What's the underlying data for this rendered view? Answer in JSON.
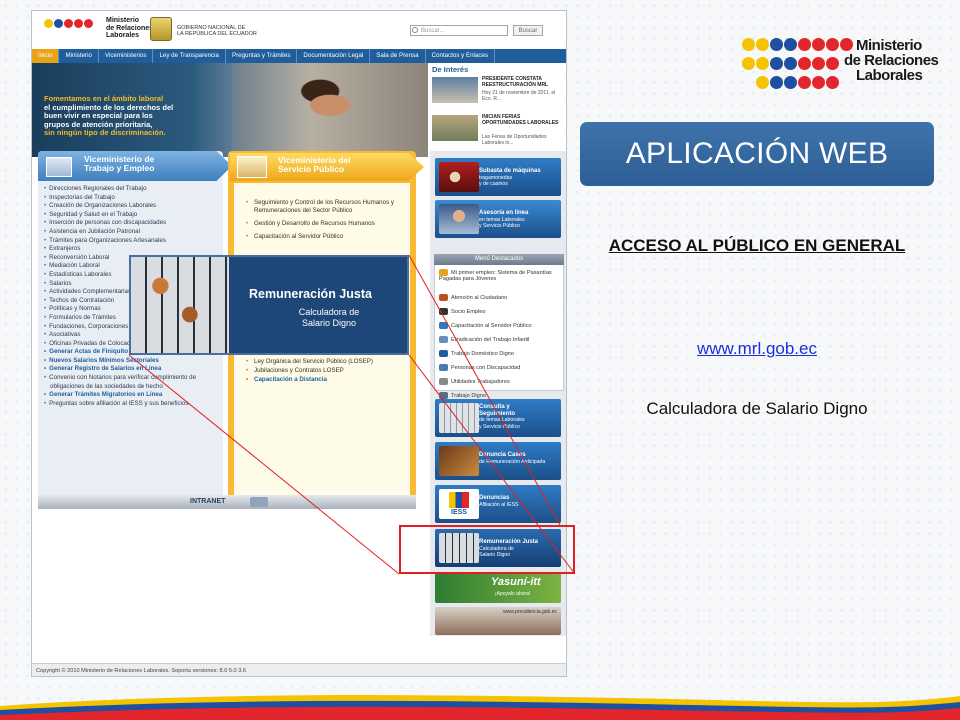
{
  "slide": {
    "brand": {
      "line1": "Ministerio",
      "line2": "de Relaciones",
      "line3": "Laborales",
      "dot_colors": [
        "#f5c400",
        "#f5c400",
        "#1f4fa0",
        "#1f4fa0",
        "#e3262c",
        "#e3262c",
        "#e3262c",
        "#e3262c"
      ]
    },
    "app_button": "APLICACIÓN WEB",
    "access_title": "ACCESO AL PÚBLICO EN GENERAL",
    "url": "www.mrl.gob.ec",
    "calc_label": "Calculadora de Salario Digno"
  },
  "site": {
    "header": {
      "mrl_line1": "Ministerio",
      "mrl_line2": "de Relaciones",
      "mrl_line3": "Laborales",
      "gob_line1": "GOBIERNO NACIONAL DE",
      "gob_line2": "LA REPÚBLICA DEL ECUADOR",
      "search_placeholder": "Buscar...",
      "search_button": "Buscar"
    },
    "nav": [
      "Inicio",
      "Ministerio",
      "Viceministerios",
      "Ley de Transparencia",
      "Preguntas y Trámites",
      "Documentación Legal",
      "Sala de Prensa",
      "Contactos y Enlaces"
    ],
    "banner": {
      "line1": "Fomentamos en el ámbito laboral",
      "line2": "el cumplimiento de los derechos del",
      "line3": "buen vivir en especial para los",
      "line4": "grupos de atención prioritaria,",
      "line5": "sin ningún tipo de discriminación."
    },
    "interes": {
      "title": "De Interés",
      "news": [
        {
          "title": "PRESIDENTE CONSTATA REESTRUCTURACIÓN MRL",
          "desc": "Hoy 21 de noviembre de 2011, el Eco. R..."
        },
        {
          "title": "INICIAN FERIAS OPORTUNIDADES LABORALES",
          "desc": "Las Ferias de Oportunidades Laborales in..."
        }
      ]
    },
    "blue_column": {
      "title_line1": "Viceministerio de",
      "title_line2": "Trabajo y Empleo",
      "links": [
        "Direcciones Regionales del Trabajo",
        "Inspectorias del Trabajo",
        "Creación de Organizaciones Laborales",
        "Seguridad y Salud en el Trabajo",
        "Inserción de personas con discapacidades",
        "Asistencia en Jubilación Patronal",
        "Trámites para Organizaciones Artesanales",
        "Extranjeros",
        "Reconversión Laboral",
        "Mediación Laboral",
        "Estadísticas Laborales",
        "Salarios",
        "Actividades Complementarias",
        "Techos de Contratación",
        "Políticas y Normas",
        "Formularios de Trámites",
        "Fundaciones, Corporaciones y",
        "Asociativas",
        "Oficinas Privadas de Colocaciones"
      ],
      "bold_links": [
        "Generar Actas de Finiquito en Línea",
        "Nuevos Salarios Mínimos Sectoriales",
        "Generar Registro de Salarios en Línea"
      ],
      "extra_links": [
        "Convenio con Notarios para verificar cumplimiento de obligaciones de las sociedades de hecho",
        "Generar Trámites Migratorios en Línea",
        "Preguntas sobre afiliación al IESS y sus beneficios"
      ]
    },
    "orange_column": {
      "title_line1": "Viceministerio del",
      "title_line2": "Servicio Público",
      "links": [
        "Seguimiento y Control de los Recursos Humanos y Remuneraciones del Sector Público",
        "Gestión y Desarrollo de Recursos Humanos",
        "Capacitación al Servidor Público"
      ],
      "lower_links": [
        "Ley Orgánica del Servicio Público (LOSEP)",
        "Jubilaciones y Contratos LOSEP"
      ],
      "bold_link": "Capacitación a Distancia"
    },
    "intranet": "INTRANET",
    "right_column": {
      "subasta_line1": "Subasta de máquinas",
      "subasta_line2": "tragamonedas",
      "subasta_line3": "y de casinos",
      "asesoria_line1": "Asesoría en línea",
      "asesoria_line2": "en temas Laborales",
      "asesoria_line3": "y Servicio Público",
      "menu_title": "Menú Destacados",
      "menu_items": [
        "Mi primer empleo: Sistema de Pasantías Pagadas para Jóvenes",
        "Atención al Ciudadano",
        "Socio Empleo",
        "Capacitación al Servidor Público",
        "Erradicación del Trabajo Infantil",
        "Trabajo Doméstico Digno",
        "Personas con Discapacidad",
        "Utilidades Trabajadores",
        "Trabajo Digno"
      ],
      "consulta_line1": "Consulta y",
      "consulta_line2": "Seguimiento",
      "consulta_line3": "de temas Laborales",
      "consulta_line4": "y Servicio Público",
      "denuncia_line1": "Denuncia Casos",
      "denuncia_line2": "de Remuneración Anticipada",
      "denuncias_line1": "Denuncias",
      "denuncias_line2": "Afiliación al IESS",
      "iess": "IESS",
      "remu_line1": "Remuneración Justa",
      "remu_line2": "Calculadora de",
      "remu_line3": "Salario Digno",
      "yasuni": "Yasuní-itt",
      "yasuni_sub": "¡Apoyalo ahora!",
      "presidencia": "www.presidencia.gob.ec"
    },
    "footer": "Copyright © 2010 Ministerio de Relaciones Laborales. Soporta versiones:  8.0   5.0   3.6",
    "popup": {
      "title": "Remuneración Justa",
      "sub1": "Calculadora de",
      "sub2": "Salario Digno"
    }
  }
}
